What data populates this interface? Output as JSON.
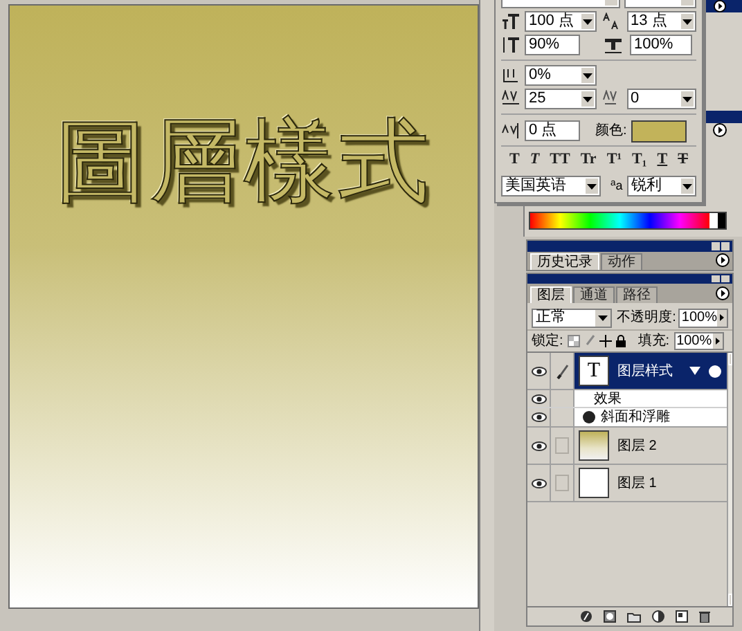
{
  "canvas": {
    "text": "圖層樣式"
  },
  "character_panel": {
    "font_size": "100 点",
    "leading": "13 点",
    "vertical_scale": "90%",
    "horizontal_scale": "100%",
    "tsume": "0%",
    "tracking": "25",
    "kerning": "0",
    "baseline_shift": "0 点",
    "color_label": "颜色:",
    "color": "#c2b35a",
    "style_buttons": [
      {
        "text": "T",
        "kind": "bold"
      },
      {
        "text": "T",
        "kind": "italic"
      },
      {
        "text": "TT",
        "kind": "caps"
      },
      {
        "text": "Tr",
        "kind": "smallcaps"
      },
      {
        "text": "T¹",
        "kind": "super"
      },
      {
        "text": "T₁",
        "kind": "sub"
      },
      {
        "text": "T",
        "kind": "underline"
      },
      {
        "text": "T",
        "kind": "strike"
      }
    ],
    "language": "美国英语",
    "antialias_label": "$^{a}$a",
    "antialias": "锐利"
  },
  "history_panel": {
    "tabs": [
      {
        "label": "历史记录",
        "selected": true
      },
      {
        "label": "动作",
        "selected": false
      }
    ]
  },
  "layers_panel": {
    "tabs": [
      {
        "label": "图层",
        "selected": true
      },
      {
        "label": "通道",
        "selected": false
      },
      {
        "label": "路径",
        "selected": false
      }
    ],
    "blend_mode": "正常",
    "opacity_label": "不透明度:",
    "opacity": "100%",
    "lock_label": "锁定:",
    "fill_label": "填充:",
    "fill": "100%",
    "layers": [
      {
        "name": "图层样式",
        "kind": "text",
        "thumbnail_text": "T",
        "selected": true,
        "visible": true,
        "effects_label": "效果",
        "effects": [
          "斜面和浮雕"
        ]
      },
      {
        "name": "图层 2",
        "kind": "gradient",
        "selected": false,
        "visible": true
      },
      {
        "name": "图层 1",
        "kind": "white",
        "selected": false,
        "visible": true
      }
    ]
  }
}
